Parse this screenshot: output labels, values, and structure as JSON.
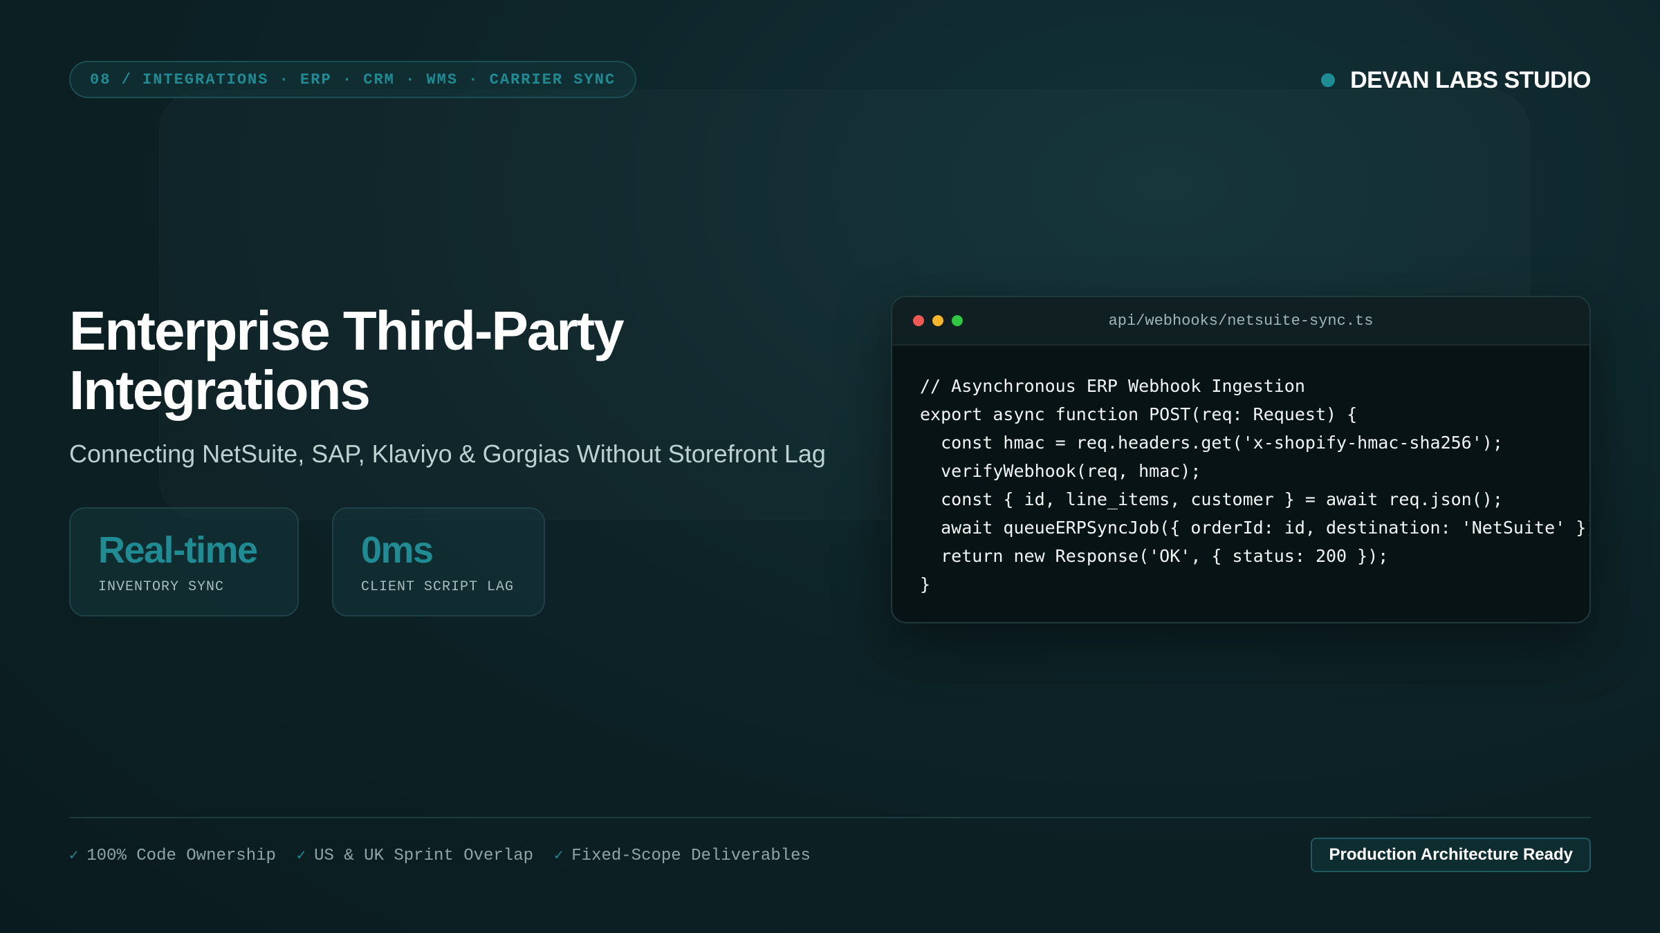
{
  "header": {
    "breadcrumb": "08 / INTEGRATIONS · ERP · CRM · WMS · CARRIER SYNC",
    "brand_name": "DEVAN LABS STUDIO"
  },
  "hero": {
    "title": "Enterprise Third-Party Integrations",
    "subtitle": "Connecting NetSuite, SAP, Klaviyo & Gorgias Without Storefront Lag"
  },
  "stats": [
    {
      "value": "Real-time",
      "label": "INVENTORY SYNC"
    },
    {
      "value": "0ms",
      "label": "CLIENT SCRIPT LAG"
    }
  ],
  "code_window": {
    "filename": "api/webhooks/netsuite-sync.ts",
    "lines": [
      "// Asynchronous ERP Webhook Ingestion",
      "export async function POST(req: Request) {",
      "  const hmac = req.headers.get('x-shopify-hmac-sha256');",
      "  verifyWebhook(req, hmac);",
      "  const { id, line_items, customer } = await req.json();",
      "  await queueERPSyncJob({ orderId: id, destination: 'NetSuite' });",
      "  return new Response('OK', { status: 200 });",
      "}"
    ]
  },
  "footer": {
    "features": [
      {
        "icon": "check-icon",
        "label": "100% Code Ownership"
      },
      {
        "icon": "check-icon",
        "label": "US & UK Sprint Overlap"
      },
      {
        "icon": "check-icon",
        "label": "Fixed-Scope Deliverables"
      }
    ],
    "badge": "Production Architecture Ready"
  },
  "colors": {
    "accent": "#1f8c93",
    "background": "#0d2327",
    "code_background": "#081316",
    "window_red": "#ee5a53",
    "window_yellow": "#f5b52b",
    "window_green": "#2fc640"
  }
}
